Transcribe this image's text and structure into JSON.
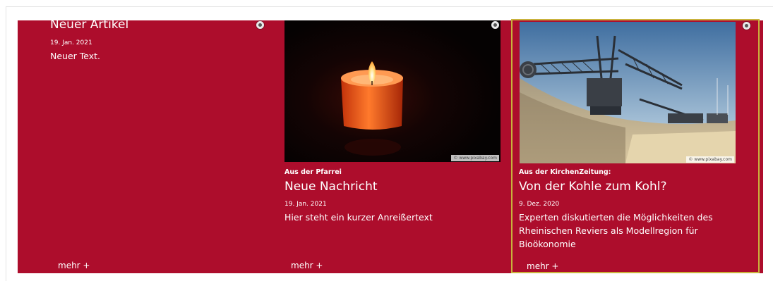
{
  "cards": [
    {
      "title": "Neuer Artikel",
      "date": "19. Jan. 2021",
      "text": "Neuer Text.",
      "more": "mehr +"
    },
    {
      "category": "Aus der Pfarrei",
      "title": "Neue Nachricht",
      "date": "19. Jan. 2021",
      "text": "Hier steht ein kurzer Anreißertext",
      "image_credit": "© www.pixabay.com",
      "more": "mehr +"
    },
    {
      "category": "Aus der KirchenZeitung:",
      "title": "Von der Kohle zum Kohl?",
      "date": "9. Dez. 2020",
      "text": "Experten diskutierten die Möglichkeiten des Rheinischen Reviers als Modellregion für Bioökonomie",
      "image_credit": "© www.pixabay.com",
      "more": "mehr +"
    }
  ],
  "scroll_top_icon": "chevron-up-icon",
  "colors": {
    "band": "#ad0d2c",
    "highlight_border": "#c9b23c"
  }
}
